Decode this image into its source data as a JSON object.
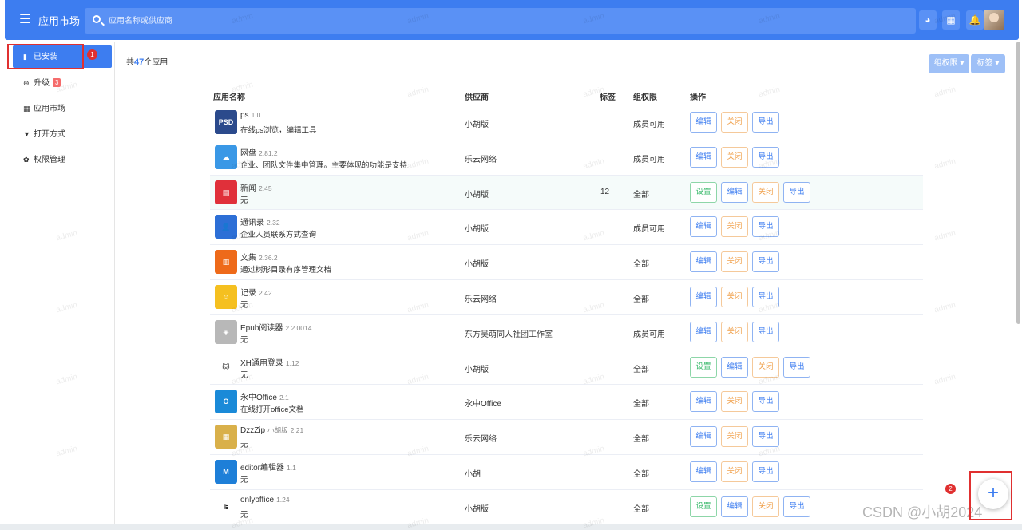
{
  "header": {
    "title": "应用市场",
    "search_placeholder": "应用名称或供应商"
  },
  "sidebar": {
    "items": [
      {
        "label": "已安装",
        "icon": "file-icon",
        "active": true
      },
      {
        "label": "升级",
        "icon": "upgrade-icon",
        "badge": "3"
      },
      {
        "label": "应用市场",
        "icon": "grid-icon"
      },
      {
        "label": "打开方式",
        "icon": "filter-icon"
      },
      {
        "label": "权限管理",
        "icon": "gear-icon"
      }
    ]
  },
  "annotations": {
    "marker1": "1",
    "marker2": "2"
  },
  "main": {
    "count_prefix": "共",
    "count": "47",
    "count_suffix": "个应用",
    "filters": {
      "group_perm": "组权限 ▾",
      "tags": "标签 ▾"
    },
    "columns": {
      "name": "应用名称",
      "vendor": "供应商",
      "tag": "标签",
      "perm": "组权限",
      "action": "操作"
    },
    "actions": {
      "set": "设置",
      "edit": "编辑",
      "close": "关闭",
      "export": "导出"
    },
    "rows": [
      {
        "name": "ps",
        "version": "1.0",
        "desc": "在线ps浏览，编辑工具",
        "vendor": "小胡版",
        "tag": "",
        "perm": "成员可用",
        "has_set": false,
        "icon_color": "#2b4a8c",
        "icon_text": "PSD"
      },
      {
        "name": "网盘",
        "version": "2.81.2",
        "desc": "企业、团队文件集中管理。主要体现的功能是支持...",
        "vendor": "乐云网络",
        "tag": "",
        "perm": "成员可用",
        "has_set": false,
        "icon_color": "#3a98e6",
        "icon_text": "☁"
      },
      {
        "name": "新闻",
        "version": "2.45",
        "desc": "无",
        "vendor": "小胡版",
        "tag": "12",
        "perm": "全部",
        "has_set": true,
        "icon_color": "#e0303a",
        "icon_text": "▤"
      },
      {
        "name": "通讯录",
        "version": "2.32",
        "desc": "企业人员联系方式查询",
        "vendor": "小胡版",
        "tag": "",
        "perm": "成员可用",
        "has_set": false,
        "icon_color": "#2d6fd6",
        "icon_text": "👤"
      },
      {
        "name": "文集",
        "version": "2.36.2",
        "desc": "通过树形目录有序管理文档",
        "vendor": "小胡版",
        "tag": "",
        "perm": "全部",
        "has_set": false,
        "icon_color": "#ee6a1a",
        "icon_text": "▥"
      },
      {
        "name": "记录",
        "version": "2.42",
        "desc": "无",
        "vendor": "乐云网络",
        "tag": "",
        "perm": "全部",
        "has_set": false,
        "icon_color": "#f5c020",
        "icon_text": "☺"
      },
      {
        "name": "Epub阅读器",
        "version": "2.2.0014",
        "desc": "无",
        "vendor": "东方吴萌同人社团工作室",
        "tag": "",
        "perm": "成员可用",
        "has_set": false,
        "icon_color": "#b8b8b8",
        "icon_text": "◈"
      },
      {
        "name": "XH通用登录",
        "version": "1.12",
        "desc": "无",
        "vendor": "小胡版",
        "tag": "",
        "perm": "全部",
        "has_set": true,
        "icon_color": "#ffffff",
        "icon_text": "🐱"
      },
      {
        "name": "永中Office",
        "version": "2.1",
        "desc": "在线打开office文档",
        "vendor": "永中Office",
        "tag": "",
        "perm": "全部",
        "has_set": false,
        "icon_color": "#1a8ad8",
        "icon_text": "O"
      },
      {
        "name": "DzzZip",
        "version": "2.21",
        "vendor_inline": "小胡版",
        "desc": "无",
        "vendor": "乐云网络",
        "tag": "",
        "perm": "全部",
        "has_set": false,
        "icon_color": "#d9b04a",
        "icon_text": "▦"
      },
      {
        "name": "editor编辑器",
        "version": "1.1",
        "desc": "无",
        "vendor": "小胡",
        "tag": "",
        "perm": "全部",
        "has_set": false,
        "icon_color": "#1e7fd8",
        "icon_text": "M"
      },
      {
        "name": "onlyoffice",
        "version": "1.24",
        "desc": "无",
        "vendor": "小胡版",
        "tag": "",
        "perm": "全部",
        "has_set": true,
        "icon_color": "#ffffff",
        "icon_text": "≋"
      }
    ]
  },
  "watermark": "admin",
  "csdn_watermark": "CSDN @小胡2024",
  "fab": "+"
}
